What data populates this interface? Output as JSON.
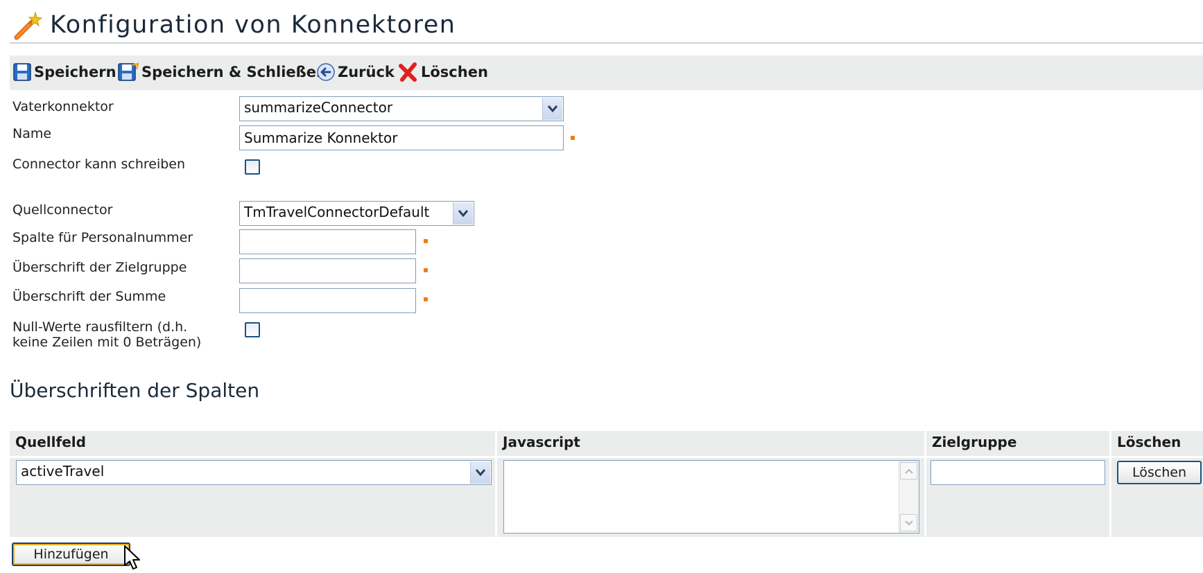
{
  "page": {
    "title": "Konfiguration von Konnektoren",
    "title_icon": "magic-wand-icon"
  },
  "toolbar": {
    "save": "Speichern",
    "save_close": "Speichern & Schließen",
    "back": "Zurück",
    "delete": "Löschen"
  },
  "form": {
    "parent_connector": {
      "label": "Vaterkonnektor",
      "value": "summarizeConnector"
    },
    "name": {
      "label": "Name",
      "value": "Summarize Konnektor"
    },
    "can_write": {
      "label": "Connector kann schreiben",
      "checked": false
    },
    "source_connector": {
      "label": "Quellconnector",
      "value": "TmTravelConnectorDefault"
    },
    "personnel_column": {
      "label": "Spalte für Personalnummer",
      "value": ""
    },
    "target_group_heading": {
      "label": "Überschrift der Zielgruppe",
      "value": ""
    },
    "sum_heading": {
      "label": "Überschrift der Summe",
      "value": ""
    },
    "filter_nulls": {
      "label_line1": "Null-Werte rausfiltern (d.h.",
      "label_line2": "keine Zeilen mit 0 Beträgen)",
      "checked": false
    }
  },
  "columns_section": {
    "heading": "Überschriften der Spalten",
    "headers": {
      "source_field": "Quellfeld",
      "javascript": "Javascript",
      "target_group": "Zielgruppe",
      "delete": "Löschen"
    },
    "rows": [
      {
        "source_field": "activeTravel",
        "javascript": "",
        "target_group": "",
        "delete_label": "Löschen"
      }
    ],
    "add_button": "Hinzufügen"
  },
  "colors": {
    "required_marker": "#f07d19",
    "toolbar_bg": "#eaedec",
    "border": "#7f9db9"
  }
}
